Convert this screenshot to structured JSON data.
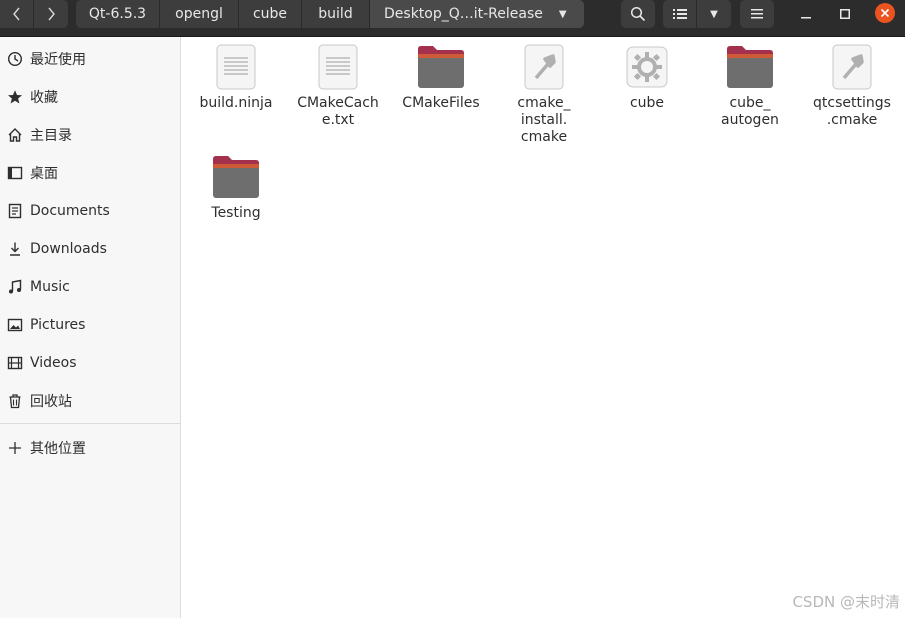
{
  "breadcrumbs": [
    "Qt-6.5.3",
    "opengl",
    "cube",
    "build",
    "Desktop_Q…it-Release"
  ],
  "sidebar": {
    "items": [
      {
        "label": "最近使用",
        "icon": "recent-icon"
      },
      {
        "label": "收藏",
        "icon": "star-icon"
      },
      {
        "label": "主目录",
        "icon": "home-icon"
      },
      {
        "label": "桌面",
        "icon": "desktop-icon"
      },
      {
        "label": "Documents",
        "icon": "documents-icon"
      },
      {
        "label": "Downloads",
        "icon": "download-icon"
      },
      {
        "label": "Music",
        "icon": "music-icon"
      },
      {
        "label": "Pictures",
        "icon": "pictures-icon"
      },
      {
        "label": "Videos",
        "icon": "videos-icon"
      },
      {
        "label": "回收站",
        "icon": "trash-icon"
      }
    ],
    "other_locations": {
      "label": "其他位置",
      "icon": "plus-icon"
    }
  },
  "files": [
    {
      "label": "build.ninja",
      "kind": "text-file"
    },
    {
      "label": "CMakeCach\ne.txt",
      "kind": "text-file"
    },
    {
      "label": "CMakeFiles",
      "kind": "folder"
    },
    {
      "label": "cmake_\ninstall.\ncmake",
      "kind": "script-file"
    },
    {
      "label": "cube",
      "kind": "executable"
    },
    {
      "label": "cube_\nautogen",
      "kind": "folder"
    },
    {
      "label": "qtcsettings\n.cmake",
      "kind": "script-file"
    },
    {
      "label": "Testing",
      "kind": "folder"
    }
  ],
  "watermark": "CSDN @末时清",
  "colors": {
    "headerbar": "#2c2c2c",
    "button": "#3d3d3d",
    "close_accent": "#e95420",
    "folder_top": "#a3304d",
    "folder_body": "#6e6e6e"
  }
}
